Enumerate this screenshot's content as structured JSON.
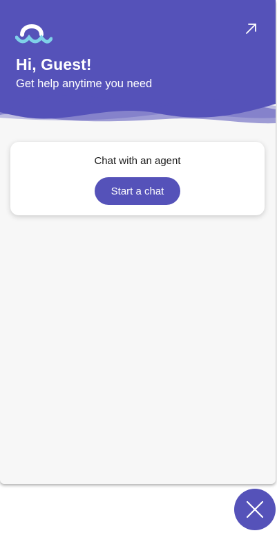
{
  "header": {
    "greeting": "Hi, Guest!",
    "subtitle": "Get help anytime you need",
    "logo_icon": "wave-logo-icon",
    "popout_icon": "arrow-up-right-icon"
  },
  "card": {
    "title": "Chat with an agent",
    "button_label": "Start a chat"
  },
  "launcher": {
    "close_icon": "close-icon"
  },
  "colors": {
    "brand": "#5552b9",
    "logo_accent": "#7fd1e8",
    "background": "#f7f7f7",
    "card": "#ffffff"
  }
}
